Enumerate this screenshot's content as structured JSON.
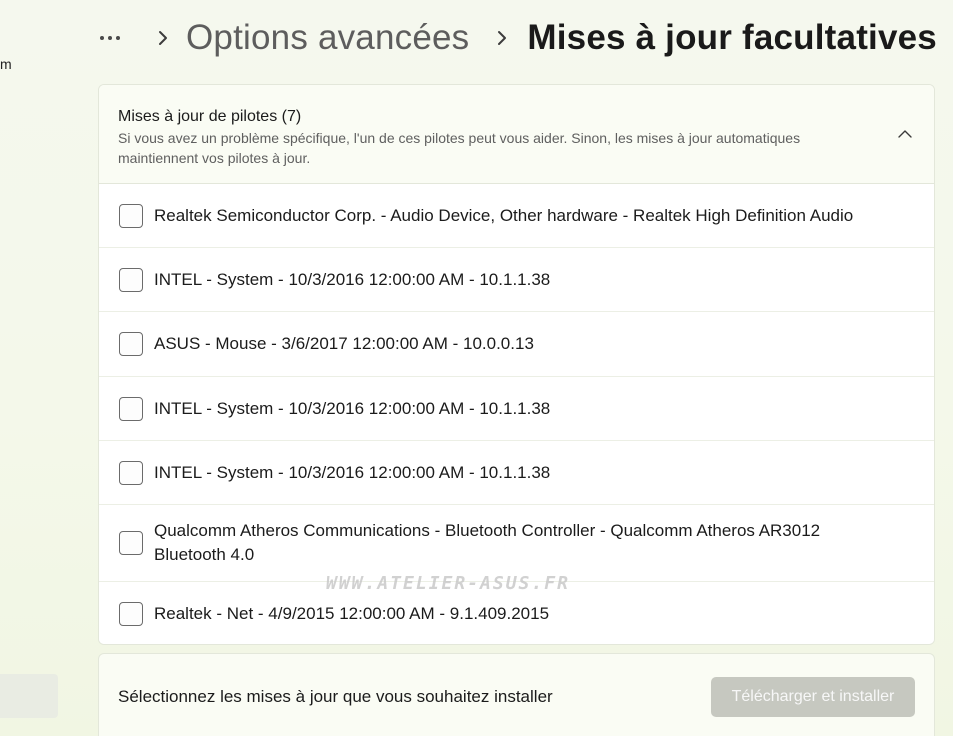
{
  "left_nav": {
    "stub_text": "m"
  },
  "breadcrumb": {
    "more_icon": "more-ellipsis-icon",
    "separator_icon": "chevron-right-icon",
    "parent_label": "Options avancées",
    "current_label": "Mises à jour facultatives"
  },
  "driver_section": {
    "title": "Mises à jour de pilotes (7)",
    "description": "Si vous avez un problème spécifique, l'un de ces pilotes peut vous aider. Sinon, les mises à jour automatiques maintiennent vos pilotes à jour.",
    "toggle_icon": "chevron-up-icon",
    "expanded": true,
    "items": [
      {
        "label": "Realtek Semiconductor Corp. - Audio Device, Other hardware - Realtek High Definition Audio",
        "checked": false
      },
      {
        "label": "INTEL - System - 10/3/2016 12:00:00 AM - 10.1.1.38",
        "checked": false
      },
      {
        "label": "ASUS - Mouse - 3/6/2017 12:00:00 AM - 10.0.0.13",
        "checked": false
      },
      {
        "label": "INTEL - System - 10/3/2016 12:00:00 AM - 10.1.1.38",
        "checked": false
      },
      {
        "label": "INTEL - System - 10/3/2016 12:00:00 AM - 10.1.1.38",
        "checked": false
      },
      {
        "label": "Qualcomm Atheros Communications - Bluetooth Controller - Qualcomm Atheros AR3012 Bluetooth 4.0",
        "checked": false
      },
      {
        "label": "Realtek - Net - 4/9/2015 12:00:00 AM - 9.1.409.2015",
        "checked": false
      }
    ]
  },
  "footer": {
    "prompt": "Sélectionnez les mises à jour que vous souhaitez installer",
    "install_button_label": "Télécharger et installer",
    "install_button_enabled": false
  },
  "watermark": {
    "text": "WWW.ATELIER-ASUS.FR"
  },
  "colors": {
    "background": "#f4f8ea",
    "card": "#fafcf5",
    "disabled_button": "#c6c8c0"
  }
}
